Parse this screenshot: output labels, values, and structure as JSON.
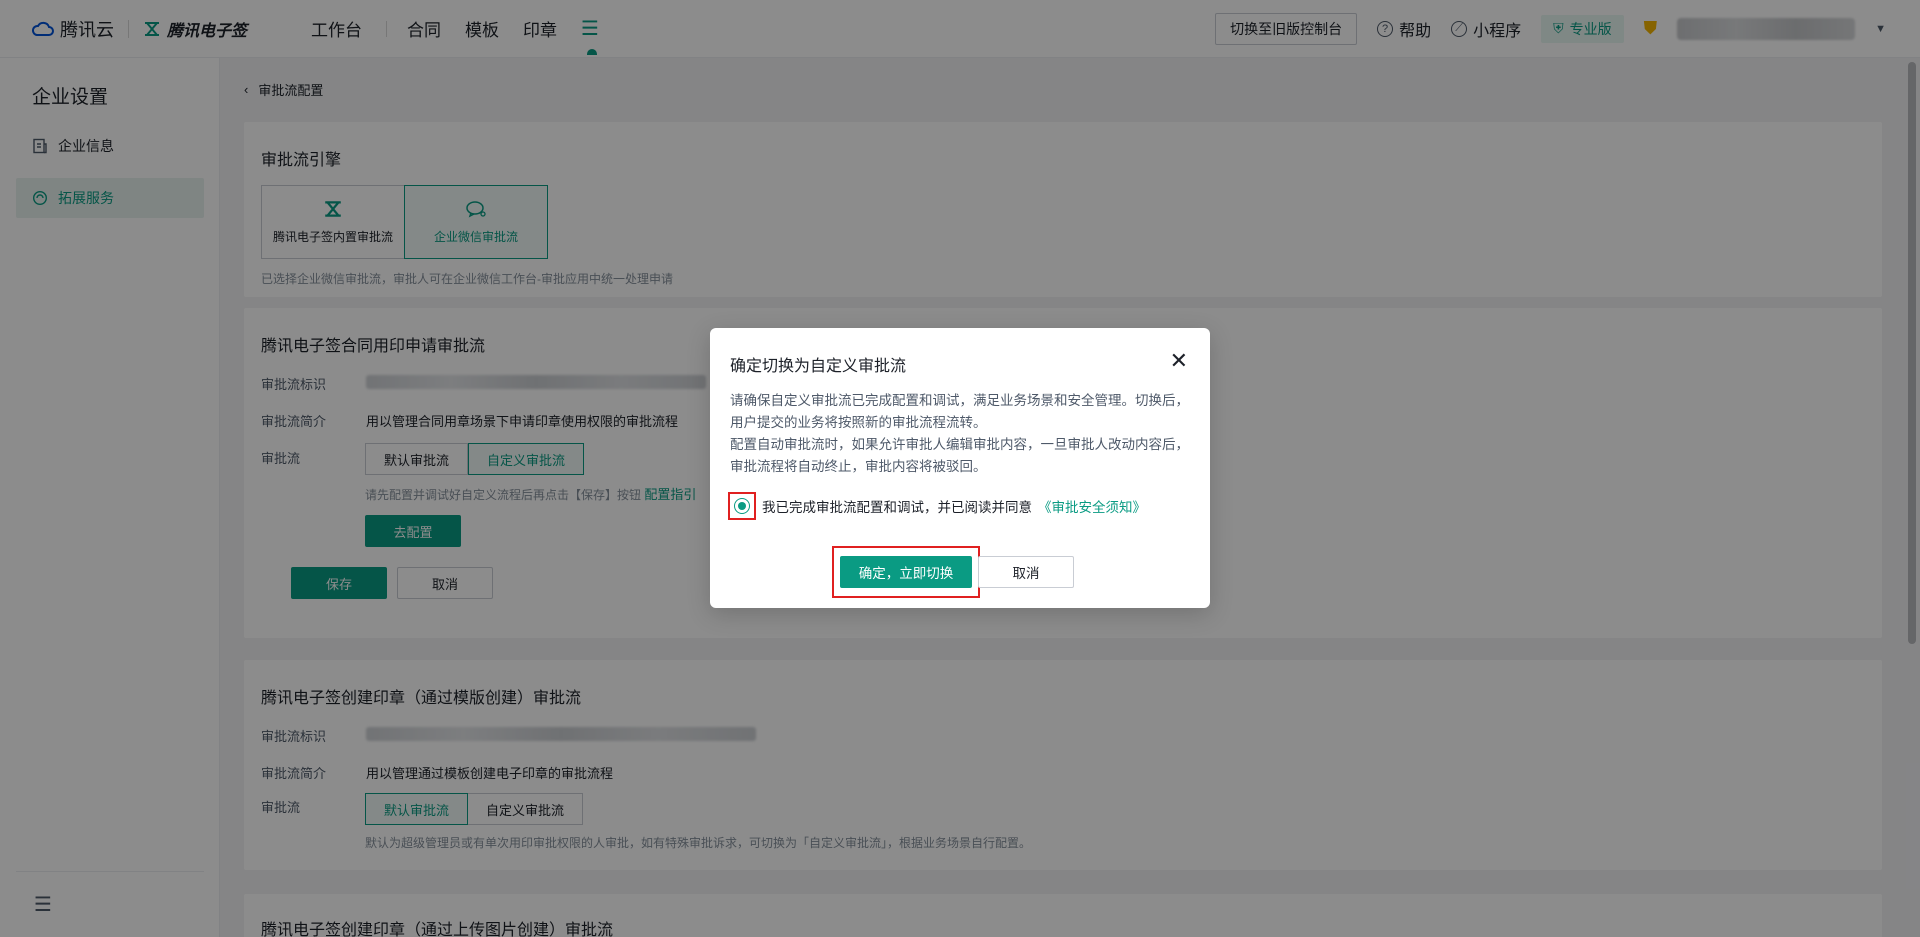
{
  "header": {
    "brand_cloud": "腾讯云",
    "brand_esign": "腾讯电子签",
    "nav": [
      "工作台",
      "合同",
      "模板",
      "印章"
    ],
    "switch_old": "切换至旧版控制台",
    "help": "帮助",
    "miniprogram": "小程序",
    "edition": "专业版"
  },
  "sidebar": {
    "title": "企业设置",
    "items": [
      {
        "label": "企业信息",
        "icon": "doc-icon"
      },
      {
        "label": "拓展服务",
        "icon": "extend-icon"
      }
    ]
  },
  "breadcrumb": "审批流配置",
  "engine": {
    "title": "审批流引擎",
    "options": [
      "腾讯电子签内置审批流",
      "企业微信审批流"
    ],
    "selected": "企业微信审批流",
    "hint": "已选择企业微信审批流，审批人可在企业微信工作台-审批应用中统一处理申请"
  },
  "section1": {
    "title": "腾讯电子签合同用印申请审批流",
    "id_label": "审批流标识",
    "desc_label": "审批流简介",
    "desc_value": "用以管理合同用章场景下申请印章使用权限的审批流程",
    "flow_label": "审批流",
    "seg": [
      "默认审批流",
      "自定义审批流"
    ],
    "hint": "请先配置并调试好自定义流程后再点击【保存】按钮",
    "guide_link": "配置指引",
    "configure_btn": "去配置",
    "save_btn": "保存",
    "cancel_btn": "取消"
  },
  "section2": {
    "title": "腾讯电子签创建印章（通过模版创建）审批流",
    "id_label": "审批流标识",
    "desc_label": "审批流简介",
    "desc_value": "用以管理通过模板创建电子印章的审批流程",
    "flow_label": "审批流",
    "seg": [
      "默认审批流",
      "自定义审批流"
    ],
    "hint": "默认为超级管理员或有单次用印审批权限的人审批，如有特殊审批诉求，可切换为「自定义审批流」，根据业务场景自行配置。"
  },
  "section3": {
    "title": "腾讯电子签创建印章（通过上传图片创建）审批流"
  },
  "modal": {
    "title": "确定切换为自定义审批流",
    "body_line1": "请确保自定义审批流已完成配置和调试，满足业务场景和安全管理。切换后，用户提交的业务将按照新的审批流程流转。",
    "body_line2": "配置自动审批流时，如果允许审批人编辑审批内容，一旦审批人改动内容后，审批流程将自动终止，审批内容将被驳回。",
    "agree_text": "我已完成审批流配置和调试，并已阅读并同意",
    "agree_link": "《审批安全须知》",
    "confirm": "确定，立即切换",
    "cancel": "取消"
  },
  "colors": {
    "accent": "#0a9b83",
    "highlight": "#e02020"
  }
}
